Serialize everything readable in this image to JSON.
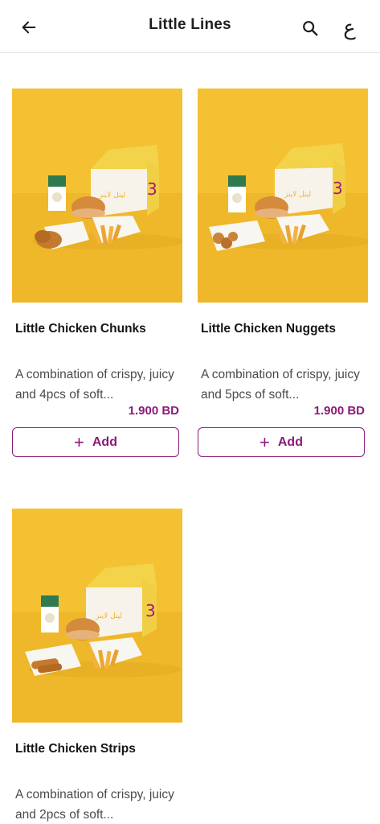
{
  "header": {
    "back_icon": "arrow-left-icon",
    "title": "Little Lines",
    "search_icon": "search-icon",
    "language_label": "ع"
  },
  "colors": {
    "accent": "#8b1a78",
    "image_background": "#f4c133"
  },
  "products": [
    {
      "name": "Little Chicken Chunks",
      "description": "A combination of crispy, juicy and 4pcs of soft...",
      "price": "1.900 BD",
      "add_label": "Add",
      "image_box_text": "ليتل لاينز",
      "image_box_logo": "3"
    },
    {
      "name": "Little Chicken Nuggets",
      "description": "A combination of crispy, juicy and 5pcs of soft...",
      "price": "1.900 BD",
      "add_label": "Add",
      "image_box_text": "ليتل لاينز",
      "image_box_logo": "3"
    },
    {
      "name": "Little Chicken Strips",
      "description": "A combination of crispy, juicy and 2pcs of soft...",
      "price": "",
      "add_label": "",
      "image_box_text": "ليتل لاينز",
      "image_box_logo": "3"
    }
  ]
}
